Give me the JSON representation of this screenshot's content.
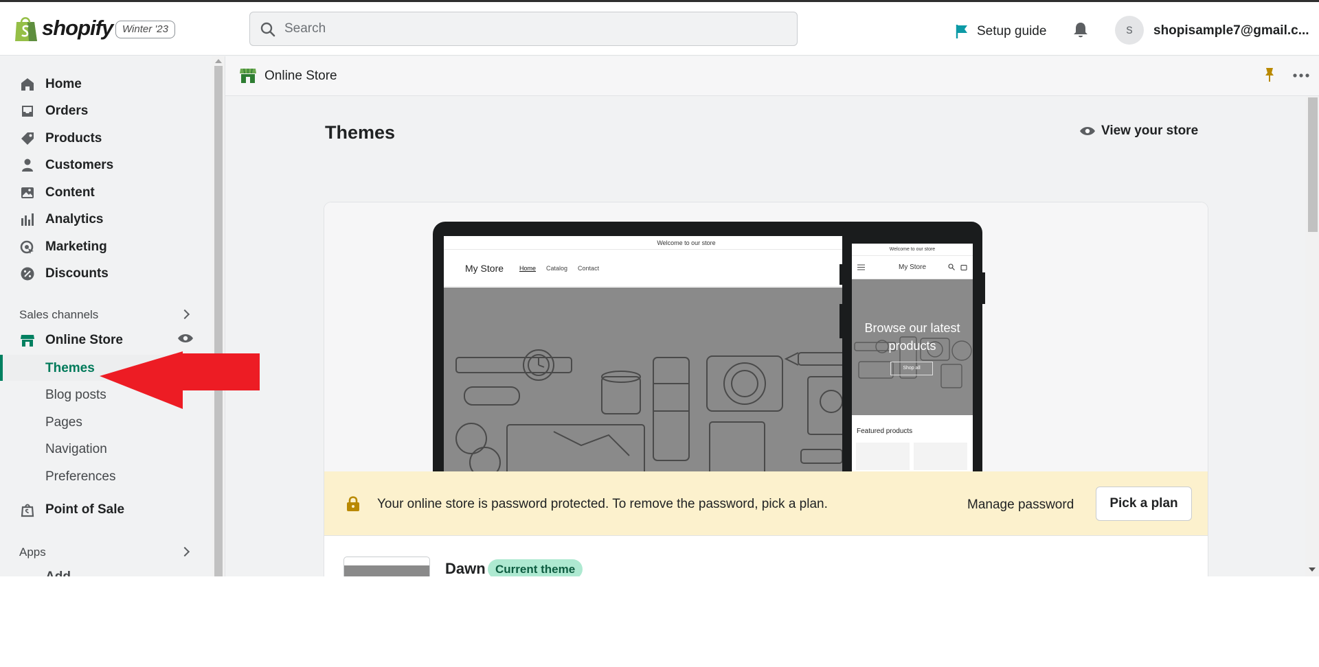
{
  "topbar": {
    "brand": "shopify",
    "edition_badge": "Winter '23",
    "search_placeholder": "Search",
    "setup_guide": "Setup guide",
    "avatar_initial": "s",
    "account_email": "shopisample7@gmail.c..."
  },
  "sidebar": {
    "items": [
      {
        "label": "Home",
        "icon": "home-icon"
      },
      {
        "label": "Orders",
        "icon": "orders-icon"
      },
      {
        "label": "Products",
        "icon": "tag-icon"
      },
      {
        "label": "Customers",
        "icon": "person-icon"
      },
      {
        "label": "Content",
        "icon": "image-icon"
      },
      {
        "label": "Analytics",
        "icon": "bar-chart-icon"
      },
      {
        "label": "Marketing",
        "icon": "target-icon"
      },
      {
        "label": "Discounts",
        "icon": "discount-icon"
      }
    ],
    "sales_channels_label": "Sales channels",
    "online_store": "Online Store",
    "sub_items": [
      "Themes",
      "Blog posts",
      "Pages",
      "Navigation",
      "Preferences"
    ],
    "point_of_sale": "Point of Sale",
    "apps_label": "Apps",
    "apps_truncated": "Add..."
  },
  "content": {
    "bar_title": "Online Store",
    "page_title": "Themes",
    "view_store": "View your store"
  },
  "preview": {
    "desktop": {
      "announcement": "Welcome to our store",
      "logo": "My Store",
      "nav": [
        "Home",
        "Catalog",
        "Contact"
      ]
    },
    "mobile": {
      "announcement": "Welcome to our store",
      "logo": "My Store",
      "hero_title": "Browse our latest products",
      "shop_all": "Shop all",
      "featured": "Featured products"
    }
  },
  "banner": {
    "message": "Your online store is password protected. To remove the password, pick a plan.",
    "manage_password": "Manage password",
    "pick_plan": "Pick a plan"
  },
  "current_theme": {
    "name": "Dawn",
    "badge": "Current theme"
  },
  "colors": {
    "accent": "#008060",
    "banner_bg": "#fcf1cd",
    "badge_bg": "#aee9d1",
    "annotation_arrow": "#ed1c24"
  }
}
